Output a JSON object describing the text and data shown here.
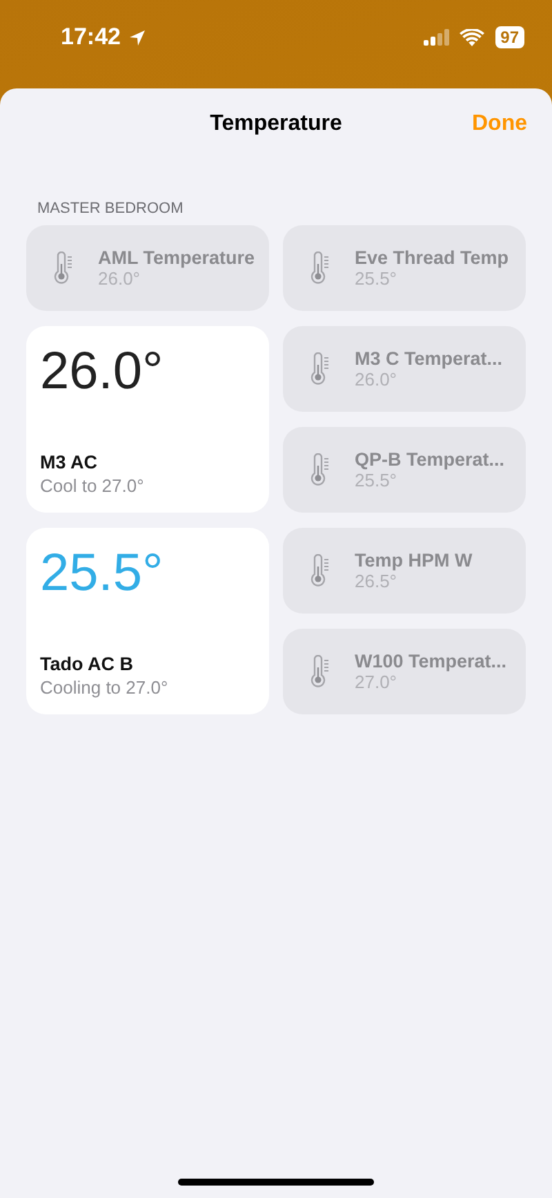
{
  "status_bar": {
    "time": "17:42",
    "battery": "97"
  },
  "header": {
    "title": "Temperature",
    "done": "Done"
  },
  "section": "MASTER BEDROOM",
  "tiles": [
    {
      "kind": "sensor",
      "name": "AML Temperature",
      "value": "26.0°"
    },
    {
      "kind": "sensor",
      "name": "Eve Thread Temp",
      "value": "25.5°"
    },
    {
      "kind": "ac",
      "temp": "26.0°",
      "name": "M3 AC",
      "status": "Cool to 27.0°",
      "active": false
    },
    {
      "kind": "sensor",
      "name": "M3 C Temperat...",
      "value": "26.0°"
    },
    {
      "kind": "sensor",
      "name": "QP-B Temperat...",
      "value": "25.5°"
    },
    {
      "kind": "ac",
      "temp": "25.5°",
      "name": "Tado AC B",
      "status": "Cooling to 27.0°",
      "active": true
    },
    {
      "kind": "sensor",
      "name": "Temp HPM W",
      "value": "26.5°"
    },
    {
      "kind": "sensor",
      "name": "W100 Temperat...",
      "value": "27.0°"
    }
  ]
}
